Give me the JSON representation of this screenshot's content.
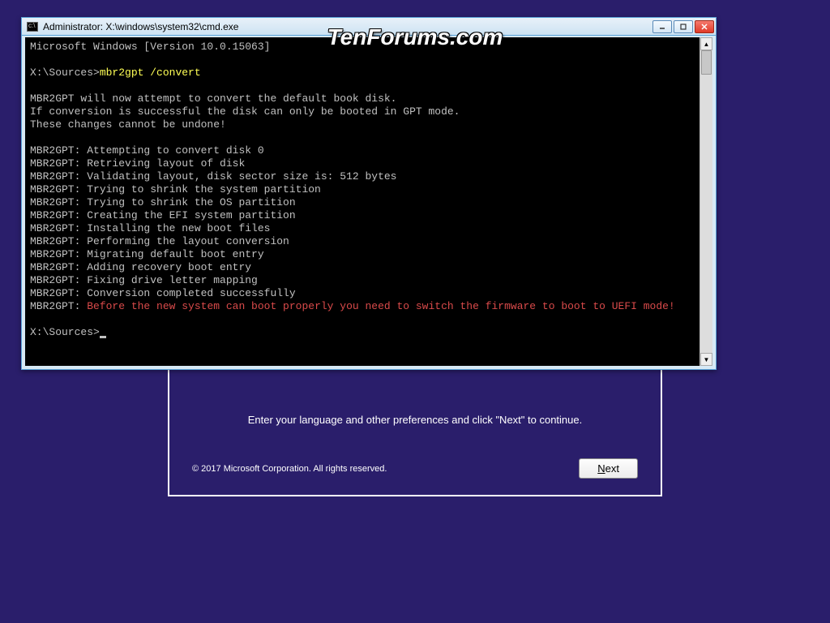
{
  "watermark": "TenForums.com",
  "setup": {
    "message": "Enter your language and other preferences and click \"Next\" to continue.",
    "copyright": "© 2017 Microsoft Corporation. All rights reserved.",
    "next_prefix": "N",
    "next_rest": "ext"
  },
  "cmd": {
    "title": "Administrator: X:\\windows\\system32\\cmd.exe",
    "version_line": "Microsoft Windows [Version 10.0.15063]",
    "prompt1": "X:\\Sources>",
    "command": "mbr2gpt /convert",
    "lines": [
      "",
      "MBR2GPT will now attempt to convert the default book disk.",
      "If conversion is successful the disk can only be booted in GPT mode.",
      "These changes cannot be undone!",
      "",
      "MBR2GPT: Attempting to convert disk 0",
      "MBR2GPT: Retrieving layout of disk",
      "MBR2GPT: Validating layout, disk sector size is: 512 bytes",
      "MBR2GPT: Trying to shrink the system partition",
      "MBR2GPT: Trying to shrink the OS partition",
      "MBR2GPT: Creating the EFI system partition",
      "MBR2GPT: Installing the new boot files",
      "MBR2GPT: Performing the layout conversion",
      "MBR2GPT: Migrating default boot entry",
      "MBR2GPT: Adding recovery boot entry",
      "MBR2GPT: Fixing drive letter mapping",
      "MBR2GPT: Conversion completed successfully"
    ],
    "warn_prefix": "MBR2GPT: ",
    "warn_text": "Before the new system can boot properly you need to switch the firmware to boot to UEFI mode!",
    "prompt2": "X:\\Sources>"
  }
}
